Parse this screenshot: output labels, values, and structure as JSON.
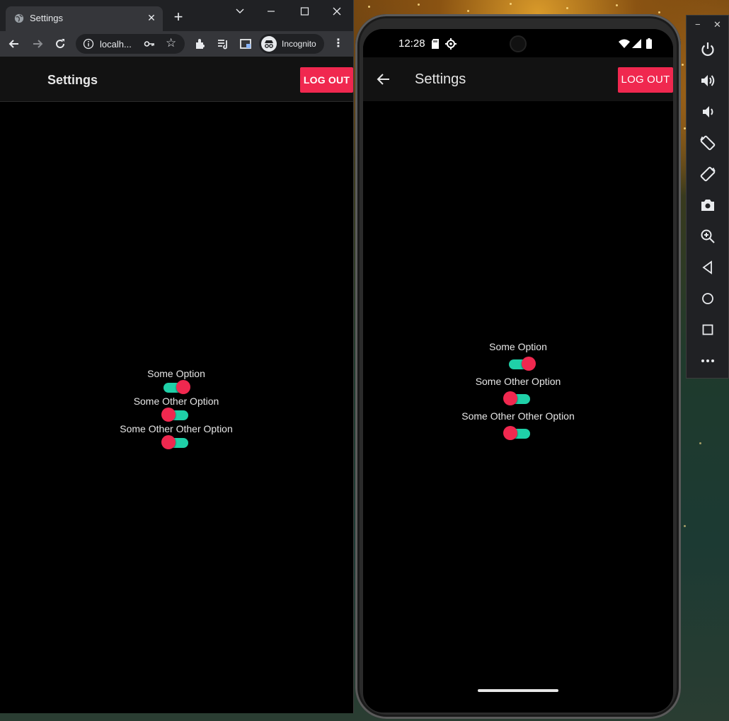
{
  "browser": {
    "tab_title": "Settings",
    "url": "localh...",
    "profile_label": "Incognito"
  },
  "web_app": {
    "title": "Settings",
    "logout_label": "LOG OUT",
    "options": [
      {
        "label": "Some Option",
        "enabled": true
      },
      {
        "label": "Some Other Option",
        "enabled": false
      },
      {
        "label": "Some Other Other Option",
        "enabled": false
      }
    ]
  },
  "phone": {
    "time": "12:28",
    "title": "Settings",
    "logout_label": "LOG OUT",
    "options": [
      {
        "label": "Some Option",
        "enabled": true
      },
      {
        "label": "Some Other Option",
        "enabled": false
      },
      {
        "label": "Some Other Other Option",
        "enabled": false
      }
    ]
  },
  "colors": {
    "accent": "#f0284f",
    "switch_track": "#1fd0a8",
    "app_bar": "#121212",
    "background": "#000000"
  },
  "emulator_toolbar": {
    "buttons": [
      "power-icon",
      "volume-up-icon",
      "volume-down-icon",
      "rotate-left-icon",
      "rotate-right-icon",
      "camera-icon",
      "zoom-icon",
      "back-icon",
      "home-icon",
      "overview-icon",
      "more-icon"
    ]
  }
}
